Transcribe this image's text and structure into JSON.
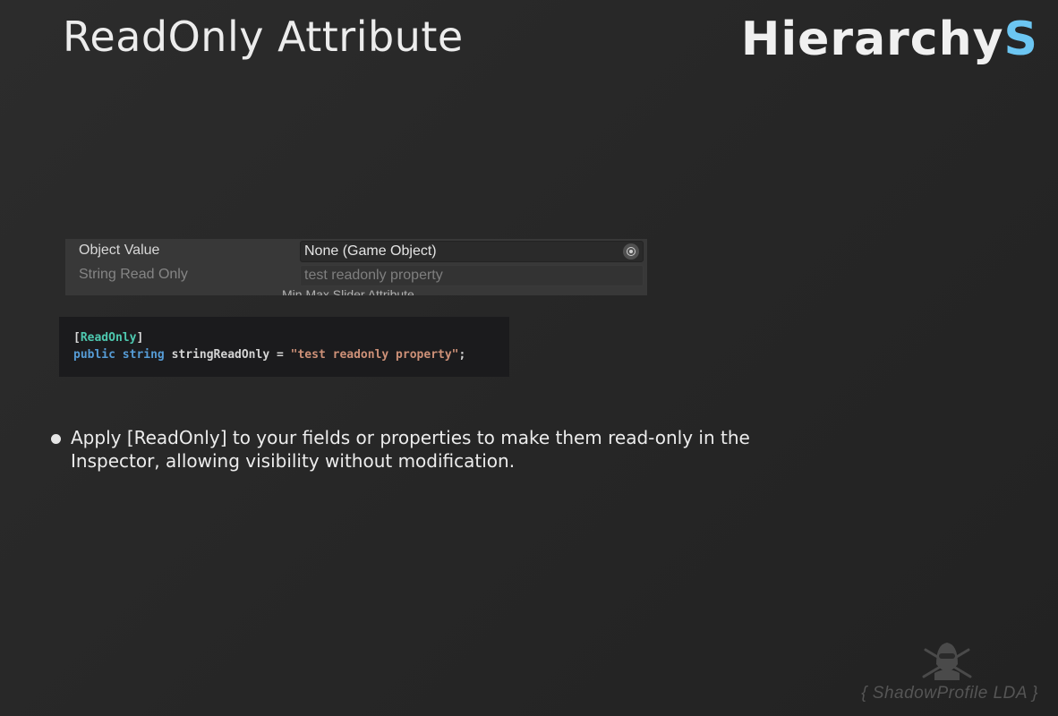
{
  "header": {
    "title": "ReadOnly Attribute",
    "logo_main": "Hierarchy",
    "logo_accent": "S"
  },
  "inspector": {
    "rows": [
      {
        "label": "Object Value",
        "value": "None (Game Object)",
        "icon": "object-picker-icon"
      },
      {
        "label": "String Read Only",
        "value": "test readonly property"
      }
    ],
    "cut_header": "Min Max Slider Attribute"
  },
  "code": {
    "bracket_open": "[",
    "attribute": "ReadOnly",
    "bracket_close": "]",
    "kw_public": "public",
    "kw_string": "string",
    "identifier": "stringReadOnly",
    "equals": "=",
    "string_literal": "\"test readonly property\"",
    "terminator": ";"
  },
  "bullet": {
    "text": "Apply [ReadOnly] to your fields or properties to make them read-only in the Inspector, allowing visibility without modification."
  },
  "watermark": {
    "text": "{ ShadowProfile LDA }",
    "icon": "ninja-swords-icon"
  },
  "colors": {
    "accent": "#6cc6f2",
    "code_attribute": "#4ec9b0",
    "code_keyword": "#569cd6",
    "code_string": "#ce9178"
  }
}
